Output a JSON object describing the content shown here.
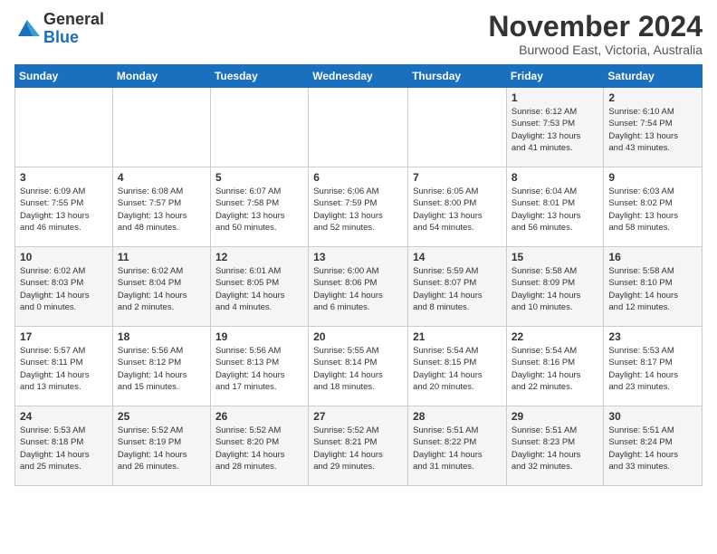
{
  "header": {
    "logo_general": "General",
    "logo_blue": "Blue",
    "month_title": "November 2024",
    "location": "Burwood East, Victoria, Australia"
  },
  "days_of_week": [
    "Sunday",
    "Monday",
    "Tuesday",
    "Wednesday",
    "Thursday",
    "Friday",
    "Saturday"
  ],
  "weeks": [
    [
      {
        "day": "",
        "info": ""
      },
      {
        "day": "",
        "info": ""
      },
      {
        "day": "",
        "info": ""
      },
      {
        "day": "",
        "info": ""
      },
      {
        "day": "",
        "info": ""
      },
      {
        "day": "1",
        "info": "Sunrise: 6:12 AM\nSunset: 7:53 PM\nDaylight: 13 hours\nand 41 minutes."
      },
      {
        "day": "2",
        "info": "Sunrise: 6:10 AM\nSunset: 7:54 PM\nDaylight: 13 hours\nand 43 minutes."
      }
    ],
    [
      {
        "day": "3",
        "info": "Sunrise: 6:09 AM\nSunset: 7:55 PM\nDaylight: 13 hours\nand 46 minutes."
      },
      {
        "day": "4",
        "info": "Sunrise: 6:08 AM\nSunset: 7:57 PM\nDaylight: 13 hours\nand 48 minutes."
      },
      {
        "day": "5",
        "info": "Sunrise: 6:07 AM\nSunset: 7:58 PM\nDaylight: 13 hours\nand 50 minutes."
      },
      {
        "day": "6",
        "info": "Sunrise: 6:06 AM\nSunset: 7:59 PM\nDaylight: 13 hours\nand 52 minutes."
      },
      {
        "day": "7",
        "info": "Sunrise: 6:05 AM\nSunset: 8:00 PM\nDaylight: 13 hours\nand 54 minutes."
      },
      {
        "day": "8",
        "info": "Sunrise: 6:04 AM\nSunset: 8:01 PM\nDaylight: 13 hours\nand 56 minutes."
      },
      {
        "day": "9",
        "info": "Sunrise: 6:03 AM\nSunset: 8:02 PM\nDaylight: 13 hours\nand 58 minutes."
      }
    ],
    [
      {
        "day": "10",
        "info": "Sunrise: 6:02 AM\nSunset: 8:03 PM\nDaylight: 14 hours\nand 0 minutes."
      },
      {
        "day": "11",
        "info": "Sunrise: 6:02 AM\nSunset: 8:04 PM\nDaylight: 14 hours\nand 2 minutes."
      },
      {
        "day": "12",
        "info": "Sunrise: 6:01 AM\nSunset: 8:05 PM\nDaylight: 14 hours\nand 4 minutes."
      },
      {
        "day": "13",
        "info": "Sunrise: 6:00 AM\nSunset: 8:06 PM\nDaylight: 14 hours\nand 6 minutes."
      },
      {
        "day": "14",
        "info": "Sunrise: 5:59 AM\nSunset: 8:07 PM\nDaylight: 14 hours\nand 8 minutes."
      },
      {
        "day": "15",
        "info": "Sunrise: 5:58 AM\nSunset: 8:09 PM\nDaylight: 14 hours\nand 10 minutes."
      },
      {
        "day": "16",
        "info": "Sunrise: 5:58 AM\nSunset: 8:10 PM\nDaylight: 14 hours\nand 12 minutes."
      }
    ],
    [
      {
        "day": "17",
        "info": "Sunrise: 5:57 AM\nSunset: 8:11 PM\nDaylight: 14 hours\nand 13 minutes."
      },
      {
        "day": "18",
        "info": "Sunrise: 5:56 AM\nSunset: 8:12 PM\nDaylight: 14 hours\nand 15 minutes."
      },
      {
        "day": "19",
        "info": "Sunrise: 5:56 AM\nSunset: 8:13 PM\nDaylight: 14 hours\nand 17 minutes."
      },
      {
        "day": "20",
        "info": "Sunrise: 5:55 AM\nSunset: 8:14 PM\nDaylight: 14 hours\nand 18 minutes."
      },
      {
        "day": "21",
        "info": "Sunrise: 5:54 AM\nSunset: 8:15 PM\nDaylight: 14 hours\nand 20 minutes."
      },
      {
        "day": "22",
        "info": "Sunrise: 5:54 AM\nSunset: 8:16 PM\nDaylight: 14 hours\nand 22 minutes."
      },
      {
        "day": "23",
        "info": "Sunrise: 5:53 AM\nSunset: 8:17 PM\nDaylight: 14 hours\nand 23 minutes."
      }
    ],
    [
      {
        "day": "24",
        "info": "Sunrise: 5:53 AM\nSunset: 8:18 PM\nDaylight: 14 hours\nand 25 minutes."
      },
      {
        "day": "25",
        "info": "Sunrise: 5:52 AM\nSunset: 8:19 PM\nDaylight: 14 hours\nand 26 minutes."
      },
      {
        "day": "26",
        "info": "Sunrise: 5:52 AM\nSunset: 8:20 PM\nDaylight: 14 hours\nand 28 minutes."
      },
      {
        "day": "27",
        "info": "Sunrise: 5:52 AM\nSunset: 8:21 PM\nDaylight: 14 hours\nand 29 minutes."
      },
      {
        "day": "28",
        "info": "Sunrise: 5:51 AM\nSunset: 8:22 PM\nDaylight: 14 hours\nand 31 minutes."
      },
      {
        "day": "29",
        "info": "Sunrise: 5:51 AM\nSunset: 8:23 PM\nDaylight: 14 hours\nand 32 minutes."
      },
      {
        "day": "30",
        "info": "Sunrise: 5:51 AM\nSunset: 8:24 PM\nDaylight: 14 hours\nand 33 minutes."
      }
    ]
  ]
}
